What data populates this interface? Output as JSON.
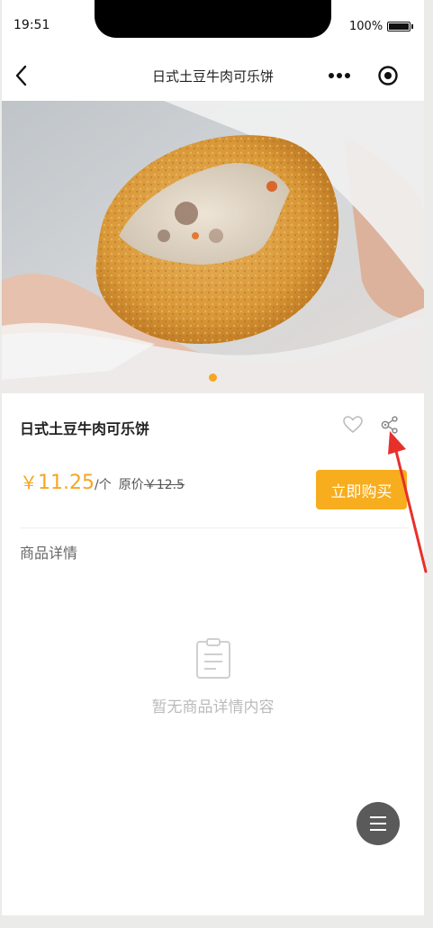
{
  "status_bar": {
    "time": "19:51",
    "battery": "100%"
  },
  "nav": {
    "title": "日式土豆牛肉可乐饼"
  },
  "product": {
    "name": "日式土豆牛肉可乐饼",
    "currency": "￥",
    "price": "11.25",
    "unit": "/个",
    "original_label": "原价",
    "original_price": "￥12.5",
    "buy_label": "立即购买"
  },
  "details": {
    "title": "商品详情",
    "empty_text": "暂无商品详情内容"
  },
  "colors": {
    "accent": "#f7ad1e",
    "price": "#f5a623",
    "arrow": "#e8302a"
  },
  "icons": [
    "back-icon",
    "more-icon",
    "target-icon",
    "heart-icon",
    "share-icon",
    "document-icon",
    "menu-icon"
  ]
}
